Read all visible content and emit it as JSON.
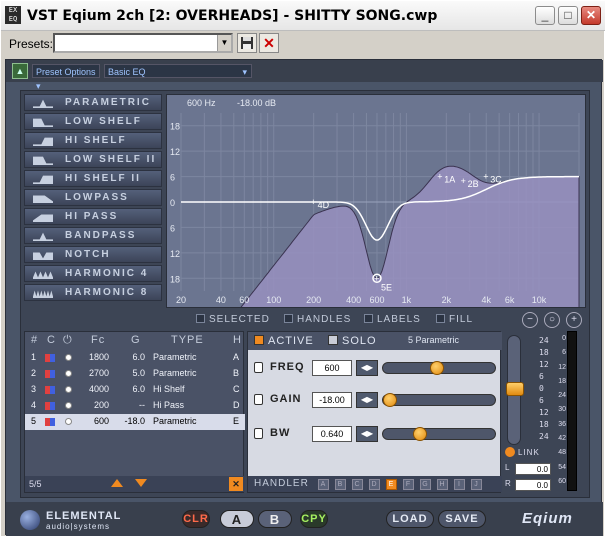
{
  "window": {
    "title": "VST Eqium 2ch [2: OVERHEADS] - SHITTY SONG.cwp",
    "icon_text": "EX EQ",
    "minimize": "_",
    "maximize": "□",
    "close": "✕"
  },
  "presets": {
    "label": "Presets:",
    "value": "",
    "save_icon": "save-icon",
    "delete_icon": "delete-icon"
  },
  "plugin_top": {
    "preset_options": "Preset Options",
    "preset_select": "Basic EQ"
  },
  "filter_types": [
    {
      "label": "PARAMETRIC"
    },
    {
      "label": "LOW SHELF"
    },
    {
      "label": "HI SHELF"
    },
    {
      "label": "LOW SHELF II"
    },
    {
      "label": "HI SHELF II"
    },
    {
      "label": "LOWPASS"
    },
    {
      "label": "HI PASS"
    },
    {
      "label": "BANDPASS"
    },
    {
      "label": "NOTCH"
    },
    {
      "label": "HARMONIC 4"
    },
    {
      "label": "HARMONIC 8"
    }
  ],
  "graph": {
    "freq_readout": "600 Hz",
    "gain_readout": "-18.00 dB",
    "y_ticks_left": [
      "18",
      "12",
      "6",
      "0",
      "6",
      "12",
      "18"
    ],
    "x_ticks": [
      "20",
      "40",
      "60",
      "100",
      "200",
      "400",
      "600",
      "1k",
      "2k",
      "4k",
      "6k",
      "10k"
    ],
    "handles": [
      {
        "label": "1A",
        "freq": 1800,
        "gain": 6.0
      },
      {
        "label": "2B",
        "freq": 2700,
        "gain": 5.0
      },
      {
        "label": "3C",
        "freq": 4000,
        "gain": 6.0
      },
      {
        "label": "4D",
        "freq": 200,
        "gain": 0
      },
      {
        "label": "5E",
        "freq": 600,
        "gain": -18.0
      }
    ]
  },
  "graph_options": {
    "selected": "SELECTED",
    "handles": "HANDLES",
    "labels": "LABELS",
    "fill": "FILL"
  },
  "table": {
    "headers": {
      "num": "#",
      "c": "C",
      "power": "⏻",
      "fc": "Fc",
      "g": "G",
      "type": "TYPE",
      "h": "H"
    },
    "rows": [
      {
        "num": "1",
        "fc": "1800",
        "g": "6.0",
        "type": "Parametric",
        "h": "A"
      },
      {
        "num": "2",
        "fc": "2700",
        "g": "5.0",
        "type": "Parametric",
        "h": "B"
      },
      {
        "num": "3",
        "fc": "4000",
        "g": "6.0",
        "type": "Hi Shelf",
        "h": "C"
      },
      {
        "num": "4",
        "fc": "200",
        "g": "--",
        "type": "Hi Pass",
        "h": "D"
      },
      {
        "num": "5",
        "fc": "600",
        "g": "-18.0",
        "type": "Parametric",
        "h": "E"
      }
    ],
    "footer_count": "5/5"
  },
  "band": {
    "active_label": "ACTIVE",
    "solo_label": "SOLO",
    "band_name": "5 Parametric",
    "freq_label": "FREQ",
    "freq_value": "600",
    "freq_level": 0.47,
    "gain_label": "GAIN",
    "gain_value": "-18.00",
    "gain_level": 0.0,
    "bw_label": "BW",
    "bw_value": "0.640",
    "bw_level": 0.3,
    "handler_label": "HANDLER",
    "handler_letters": [
      "A",
      "B",
      "C",
      "D",
      "E",
      "F",
      "G",
      "H",
      "I",
      "J"
    ],
    "handler_selected": "E"
  },
  "output": {
    "ticks": [
      "24",
      "18",
      "12",
      "6",
      "0",
      "6",
      "12",
      "18",
      "24"
    ],
    "meter_ticks": [
      "0",
      "6",
      "12",
      "18",
      "24",
      "30",
      "36",
      "42",
      "48",
      "54",
      "60"
    ],
    "link_label": "LINK",
    "l_label": "L",
    "l_value": "0.0",
    "r_label": "R",
    "r_value": "0.0"
  },
  "bottom": {
    "logo_line1": "ELEMENTAL",
    "logo_line2": "audio|systems",
    "clr": "CLR",
    "a": "A",
    "b": "B",
    "cpy": "CPY",
    "load": "LOAD",
    "save": "SAVE",
    "brand": "Eqium"
  },
  "colors": {
    "accent_orange": "#f08a20",
    "panel": "#3d4555",
    "graph_bg": "#6b7590",
    "curve_fill": "#9890c0"
  }
}
